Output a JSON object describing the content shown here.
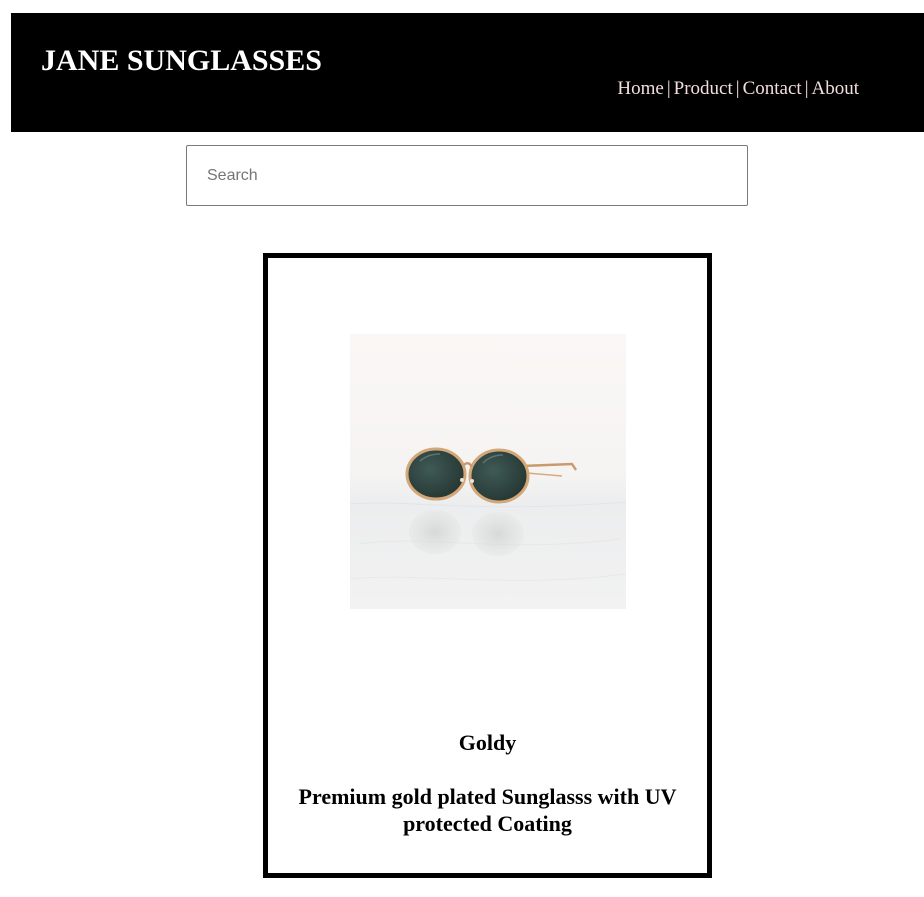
{
  "header": {
    "brand": "JANE SUNGLASSES",
    "nav": [
      {
        "label": "Home"
      },
      {
        "label": "Product"
      },
      {
        "label": "Contact"
      },
      {
        "label": "About"
      }
    ],
    "separator": "|",
    "background": "#000000",
    "nav_color": "#f3dede"
  },
  "search": {
    "placeholder": "Search",
    "value": ""
  },
  "product": {
    "name": "Goldy",
    "description": "Premium gold plated Sunglasss with UV protected Coating",
    "image_icon": "sunglasses-photo"
  }
}
